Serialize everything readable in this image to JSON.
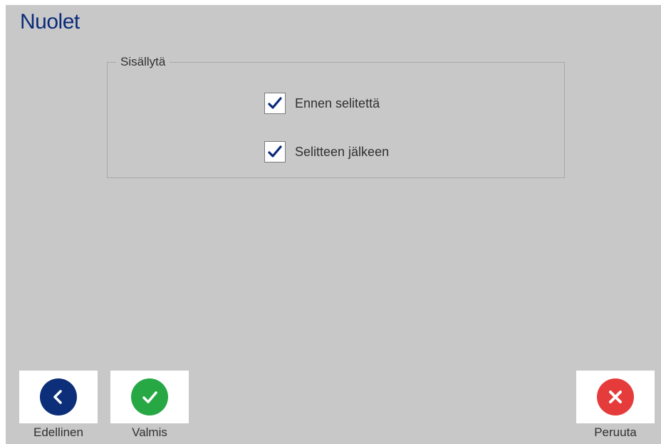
{
  "header": {
    "title": "Nuolet"
  },
  "include_group": {
    "legend": "Sisällytä",
    "options": [
      {
        "label": "Ennen selitettä",
        "checked": true
      },
      {
        "label": "Selitteen jälkeen",
        "checked": true
      }
    ]
  },
  "footer": {
    "previous_label": "Edellinen",
    "done_label": "Valmis",
    "cancel_label": "Peruuta"
  },
  "icons": {
    "previous": "chevron-left-icon",
    "done": "checkmark-icon",
    "cancel": "close-icon"
  },
  "colors": {
    "title": "#0a2a7a",
    "background": "#c8c8c8",
    "previous_button": "#0d2e78",
    "done_button": "#27a844",
    "cancel_button": "#e53b3b",
    "checkmark": "#0a2a7a"
  }
}
